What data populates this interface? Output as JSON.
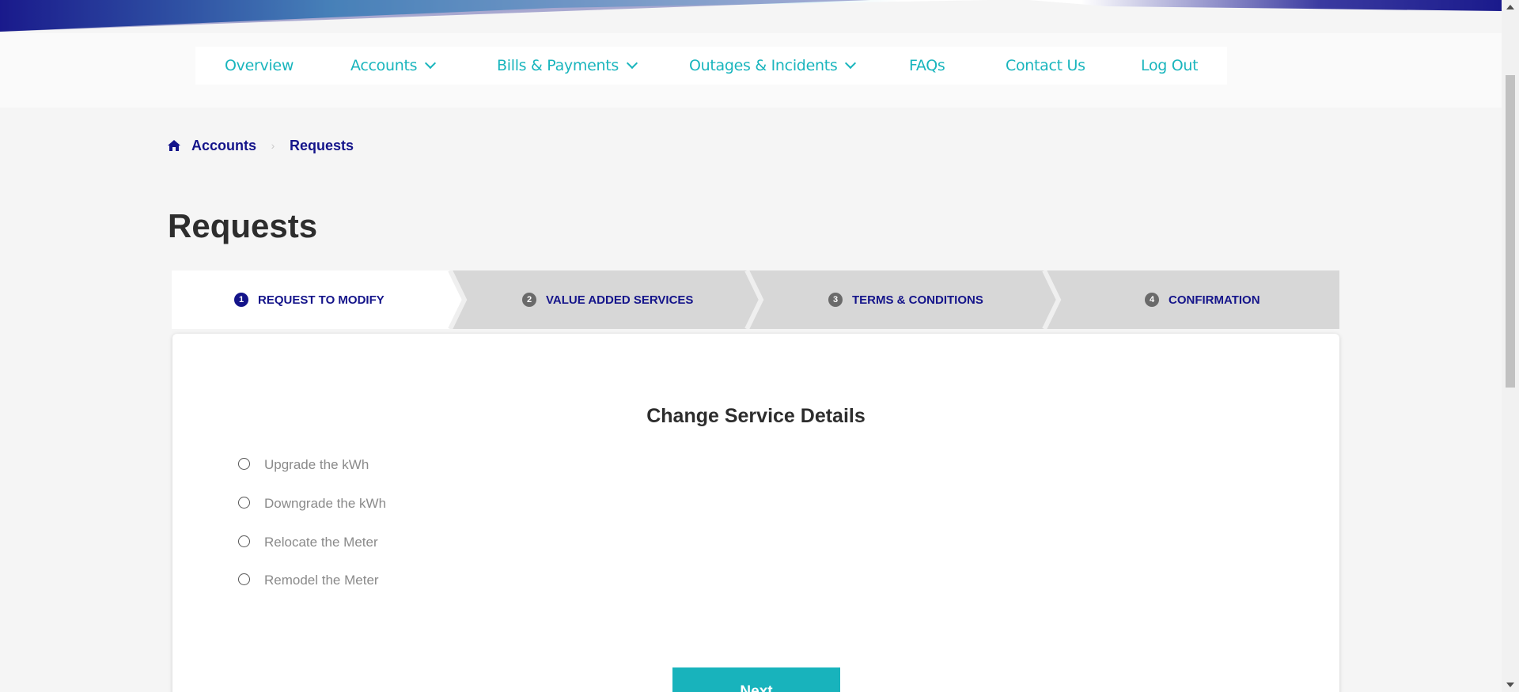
{
  "nav": {
    "overview": "Overview",
    "accounts": "Accounts",
    "bills_payments": "Bills & Payments",
    "outages_incidents": "Outages & Incidents",
    "faqs": "FAQs",
    "contact_us": "Contact Us",
    "log_out": "Log Out"
  },
  "breadcrumb": {
    "items": [
      "Accounts",
      "Requests"
    ]
  },
  "page_title": "Requests",
  "steps": [
    {
      "number": "1",
      "label": "REQUEST TO MODIFY",
      "active": true
    },
    {
      "number": "2",
      "label": "VALUE ADDED SERVICES",
      "active": false
    },
    {
      "number": "3",
      "label": "TERMS & CONDITIONS",
      "active": false
    },
    {
      "number": "4",
      "label": "CONFIRMATION",
      "active": false
    }
  ],
  "card": {
    "title": "Change Service Details",
    "options": [
      "Upgrade the kWh",
      "Downgrade the kWh",
      "Relocate the Meter",
      "Remodel the Meter"
    ],
    "next_label": "Next"
  },
  "colors": {
    "accent": "#19b5bd",
    "navy": "#14148a",
    "page_bg": "#f5f5f5"
  }
}
